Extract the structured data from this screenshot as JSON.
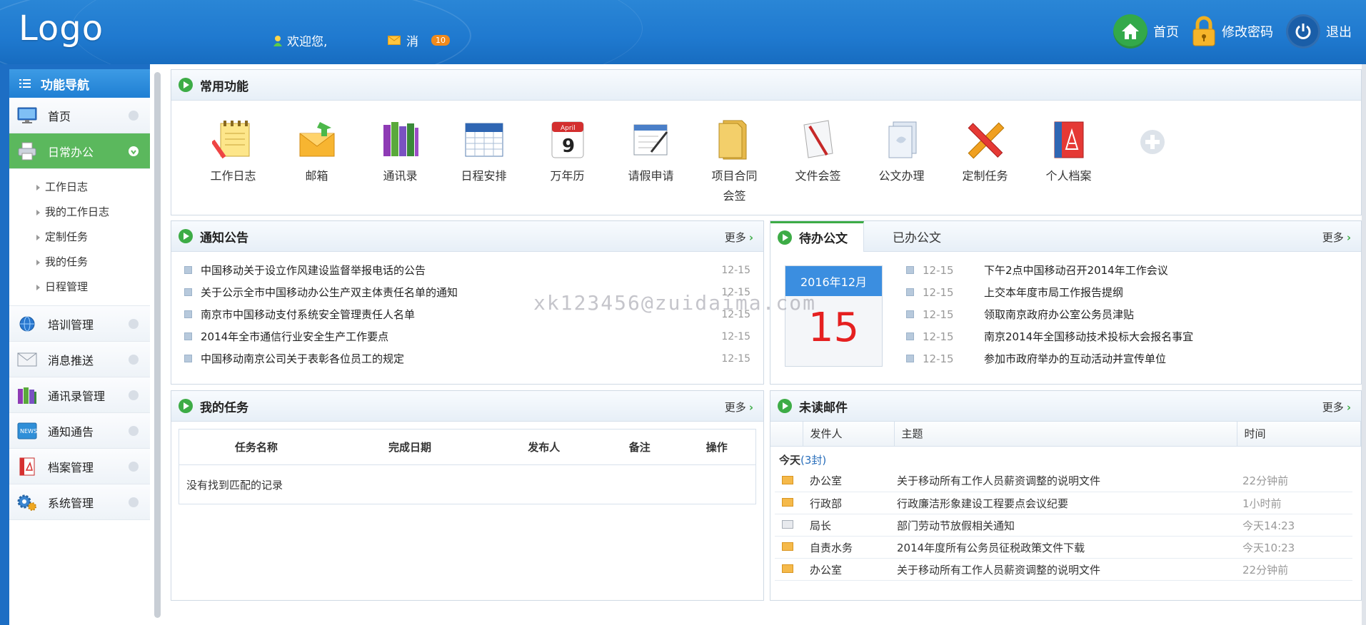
{
  "header": {
    "logo": "Logo",
    "welcome": "欢迎您,",
    "message_label": "消",
    "message_count": "10",
    "home": "首页",
    "change_password": "修改密码",
    "logout": "退出"
  },
  "sidebar": {
    "title": "功能导航",
    "items": [
      {
        "label": "首页",
        "icon": "monitor-icon"
      },
      {
        "label": "日常办公",
        "icon": "printer-icon",
        "active": true
      },
      {
        "label": "培训管理",
        "icon": "globe-icon"
      },
      {
        "label": "消息推送",
        "icon": "envelope-icon"
      },
      {
        "label": "通讯录管理",
        "icon": "books-icon"
      },
      {
        "label": "通知通告",
        "icon": "news-icon"
      },
      {
        "label": "档案管理",
        "icon": "pdf-icon"
      },
      {
        "label": "系统管理",
        "icon": "gears-icon"
      }
    ],
    "sub_items": [
      "工作日志",
      "我的工作日志",
      "定制任务",
      "我的任务",
      "日程管理"
    ]
  },
  "common": {
    "title": "常用功能",
    "items": [
      "工作日志",
      "邮箱",
      "通讯录",
      "日程安排",
      "万年历",
      "请假申请",
      "项目合同会签",
      "文件会签",
      "公文办理",
      "定制任务",
      "个人档案"
    ]
  },
  "notices": {
    "title": "通知公告",
    "more": "更多",
    "items": [
      {
        "text": "中国移动关于设立作风建设监督举报电话的公告",
        "date": "12-15"
      },
      {
        "text": "关于公示全市中国移动办公生产双主体责任名单的通知",
        "date": "12-15"
      },
      {
        "text": "南京市中国移动支付系统安全管理责任人名单",
        "date": "12-15"
      },
      {
        "text": "2014年全市通信行业安全生产工作要点",
        "date": "12-15"
      },
      {
        "text": "中国移动南京公司关于表彰各位员工的规定",
        "date": "12-15"
      }
    ]
  },
  "docs": {
    "tab_pending": "待办公文",
    "tab_done": "已办公文",
    "more": "更多",
    "calendar_month": "2016年12月",
    "calendar_day": "15",
    "items": [
      {
        "date": "12-15",
        "text": "下午2点中国移动召开2014年工作会议"
      },
      {
        "date": "12-15",
        "text": "上交本年度市局工作报告提纲"
      },
      {
        "date": "12-15",
        "text": "领取南京政府办公室公务员津贴"
      },
      {
        "date": "12-15",
        "text": "南京2014年全国移动技术投标大会报名事宜"
      },
      {
        "date": "12-15",
        "text": "参加市政府举办的互动活动并宣传单位"
      }
    ]
  },
  "tasks": {
    "title": "我的任务",
    "more": "更多",
    "columns": [
      "任务名称",
      "完成日期",
      "发布人",
      "备注",
      "操作"
    ],
    "empty": "没有找到匹配的记录"
  },
  "mail": {
    "title": "未读邮件",
    "more": "更多",
    "columns": [
      "发件人",
      "主题",
      "时间"
    ],
    "today": "今天",
    "today_count": "(3封)",
    "rows": [
      {
        "from": "办公室",
        "subject": "关于移动所有工作人员薪资调整的说明文件",
        "time": "22分钟前",
        "read": false
      },
      {
        "from": "行政部",
        "subject": "行政廉洁形象建设工程要点会议纪要",
        "time": "1小时前",
        "read": false
      },
      {
        "from": "局长",
        "subject": "部门劳动节放假相关通知",
        "time": "今天14:23",
        "read": true
      },
      {
        "from": "自责水务",
        "subject": "2014年度所有公务员征税政策文件下载",
        "time": "今天10:23",
        "read": false
      },
      {
        "from": "办公室",
        "subject": "关于移动所有工作人员薪资调整的说明文件",
        "time": "22分钟前",
        "read": false
      }
    ]
  },
  "watermark": "xk123456@zuidaima.com"
}
